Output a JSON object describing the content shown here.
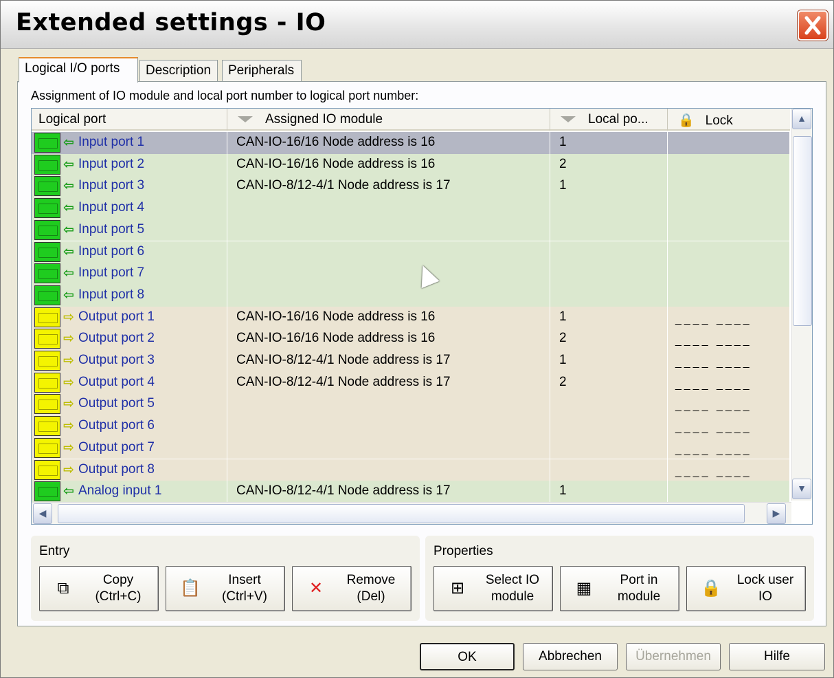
{
  "window": {
    "title": "Extended settings - IO"
  },
  "tabs": [
    {
      "label": "Logical I/O ports",
      "active": true
    },
    {
      "label": "Description"
    },
    {
      "label": "Peripherals"
    }
  ],
  "caption": "Assignment of IO module and local port number to logical port number:",
  "grid": {
    "columns": [
      "Logical port",
      "Assigned IO module",
      "Local po...",
      "Lock"
    ],
    "rows": [
      {
        "type": "in",
        "port": "Input port 1",
        "module": "CAN-IO-16/16 Node address is 16",
        "local": "1",
        "lock": "",
        "selected": true
      },
      {
        "type": "in",
        "port": "Input port 2",
        "module": "CAN-IO-16/16 Node address is 16",
        "local": "2",
        "lock": ""
      },
      {
        "type": "in",
        "port": "Input port 3",
        "module": "CAN-IO-8/12-4/1 Node address is 17",
        "local": "1",
        "lock": ""
      },
      {
        "type": "in",
        "port": "Input port 4",
        "module": "",
        "local": "",
        "lock": ""
      },
      {
        "type": "in",
        "port": "Input port 5",
        "module": "",
        "local": "",
        "lock": ""
      },
      {
        "type": "in",
        "port": "Input port 6",
        "module": "",
        "local": "",
        "lock": ""
      },
      {
        "type": "in",
        "port": "Input port 7",
        "module": "",
        "local": "",
        "lock": ""
      },
      {
        "type": "in",
        "port": "Input port 8",
        "module": "",
        "local": "",
        "lock": ""
      },
      {
        "type": "out",
        "port": "Output port 1",
        "module": "CAN-IO-16/16 Node address is 16",
        "local": "1",
        "lock": "____ ____"
      },
      {
        "type": "out",
        "port": "Output port 2",
        "module": "CAN-IO-16/16 Node address is 16",
        "local": "2",
        "lock": "____ ____"
      },
      {
        "type": "out",
        "port": "Output port 3",
        "module": "CAN-IO-8/12-4/1 Node address is 17",
        "local": "1",
        "lock": "____ ____"
      },
      {
        "type": "out",
        "port": "Output port 4",
        "module": "CAN-IO-8/12-4/1 Node address is 17",
        "local": "2",
        "lock": "____ ____"
      },
      {
        "type": "out",
        "port": "Output port 5",
        "module": "",
        "local": "",
        "lock": "____ ____"
      },
      {
        "type": "out",
        "port": "Output port 6",
        "module": "",
        "local": "",
        "lock": "____ ____"
      },
      {
        "type": "out",
        "port": "Output port 7",
        "module": "",
        "local": "",
        "lock": "____ ____"
      },
      {
        "type": "out",
        "port": "Output port 8",
        "module": "",
        "local": "",
        "lock": "____ ____"
      },
      {
        "type": "ana",
        "port": "Analog input 1",
        "module": "CAN-IO-8/12-4/1 Node address is 17",
        "local": "1",
        "lock": ""
      }
    ]
  },
  "entry_group": {
    "title": "Entry",
    "buttons": [
      {
        "label": "Copy\n(Ctrl+C)",
        "icon": "copy-icon",
        "glyph": "⧉"
      },
      {
        "label": "Insert\n(Ctrl+V)",
        "icon": "paste-icon",
        "glyph": "📋"
      },
      {
        "label": "Remove\n(Del)",
        "icon": "remove-icon",
        "glyph": "✕"
      }
    ]
  },
  "properties_group": {
    "title": "Properties",
    "buttons": [
      {
        "label": "Select IO\nmodule",
        "icon": "select-module-icon",
        "glyph": "⊞"
      },
      {
        "label": "Port in\nmodule",
        "icon": "port-in-module-icon",
        "glyph": "▦"
      },
      {
        "label": "Lock user\nIO",
        "icon": "lock-icon",
        "glyph": "🔒"
      }
    ]
  },
  "dialog_buttons": {
    "ok": "OK",
    "cancel": "Abbrechen",
    "apply": "Übernehmen",
    "help": "Hilfe"
  },
  "colors": {
    "input_row": "#dbe8cf",
    "output_row": "#ebe4d3",
    "selected_row": "#b4b7c4"
  }
}
